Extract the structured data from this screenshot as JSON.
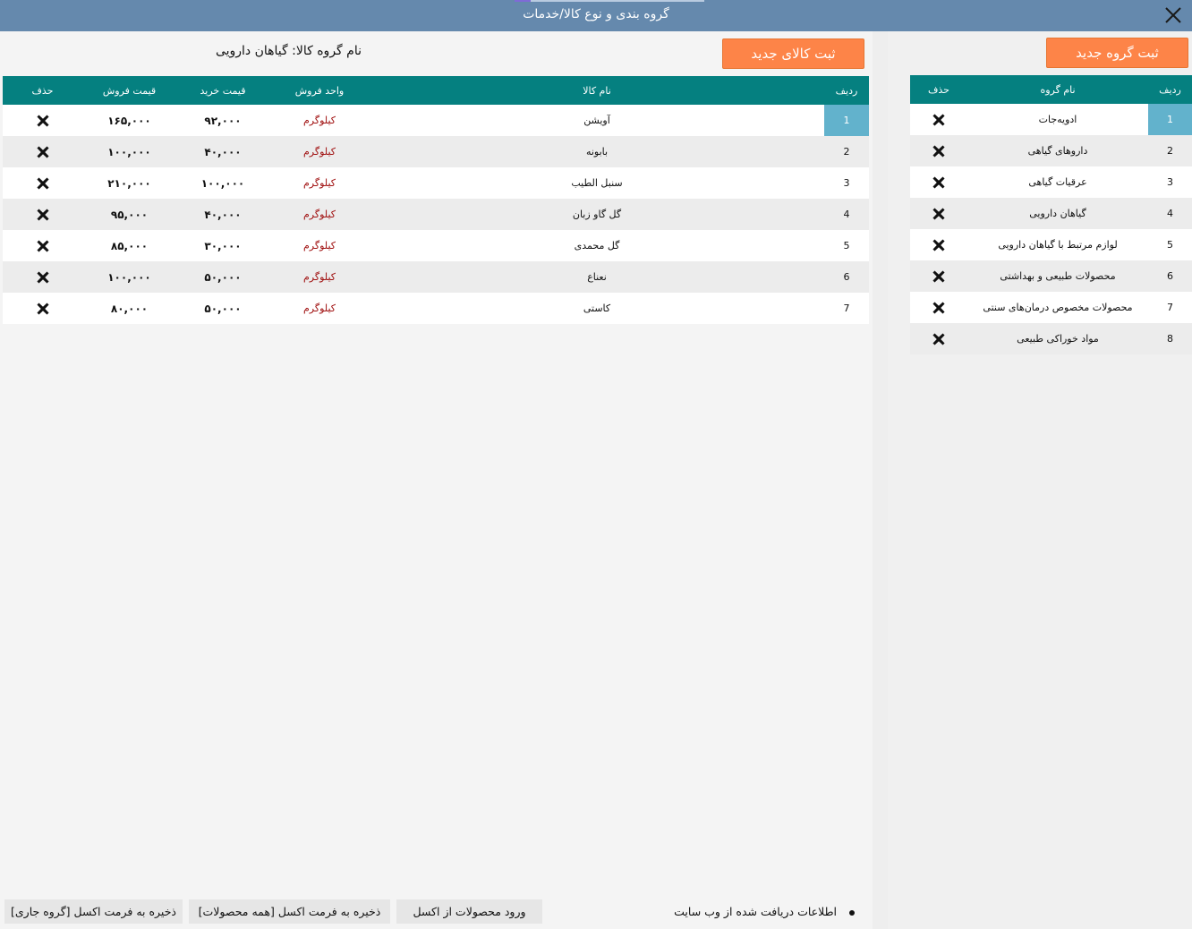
{
  "window": {
    "title": "گروه بندی و نوع کالا/خدمات"
  },
  "buttons": {
    "new_group": "ثبت گروه جدید",
    "new_product": "ثبت کالای جدید",
    "import_excel": "ورود محصولات از اکسل",
    "export_all": "ذخیره به فرمت اکسل [همه محصولات]",
    "export_current": "ذخیره به فرمت اکسل [گروه جاری]"
  },
  "selected_group": {
    "label": "نام گروه کالا:",
    "value": "گیاهان دارویی"
  },
  "status": {
    "info": "اطلاعات دریافت شده از وب سایت"
  },
  "groups_table": {
    "headers": {
      "row": "ردیف",
      "name": "نام گروه",
      "delete": "حذف"
    },
    "rows": [
      {
        "row": "1",
        "name": "ادویه‌جات"
      },
      {
        "row": "2",
        "name": "داروهای گیاهی"
      },
      {
        "row": "3",
        "name": "عرقیات گیاهی"
      },
      {
        "row": "4",
        "name": "گیاهان دارویی"
      },
      {
        "row": "5",
        "name": "لوازم مرتبط با گیاهان دارویی"
      },
      {
        "row": "6",
        "name": "محصولات طبیعی و بهداشتی"
      },
      {
        "row": "7",
        "name": "محصولات مخصوص درمان‌های سنتی"
      },
      {
        "row": "8",
        "name": "مواد خوراکی طبیعی"
      }
    ]
  },
  "products_table": {
    "headers": {
      "row": "ردیف",
      "name": "نام کالا",
      "unit": "واحد فروش",
      "buy": "قیمت خرید",
      "sell": "قیمت فروش",
      "delete": "حذف"
    },
    "rows": [
      {
        "row": "1",
        "name": "آویشن",
        "unit": "کیلوگرم",
        "buy": "۹۲,۰۰۰",
        "sell": "۱۶۵,۰۰۰"
      },
      {
        "row": "2",
        "name": "بابونه",
        "unit": "کیلوگرم",
        "buy": "۴۰,۰۰۰",
        "sell": "۱۰۰,۰۰۰"
      },
      {
        "row": "3",
        "name": "سنبل الطیب",
        "unit": "کیلوگرم",
        "buy": "۱۰۰,۰۰۰",
        "sell": "۲۱۰,۰۰۰"
      },
      {
        "row": "4",
        "name": "گل گاو زبان",
        "unit": "کیلوگرم",
        "buy": "۴۰,۰۰۰",
        "sell": "۹۵,۰۰۰"
      },
      {
        "row": "5",
        "name": "گل محمدی",
        "unit": "کیلوگرم",
        "buy": "۳۰,۰۰۰",
        "sell": "۸۵,۰۰۰"
      },
      {
        "row": "6",
        "name": "نعناع",
        "unit": "کیلوگرم",
        "buy": "۵۰,۰۰۰",
        "sell": "۱۰۰,۰۰۰"
      },
      {
        "row": "7",
        "name": "کاستی",
        "unit": "کیلوگرم",
        "buy": "۵۰,۰۰۰",
        "sell": "۸۰,۰۰۰"
      }
    ]
  },
  "colors": {
    "titlebar": "#6589ad",
    "header": "#058080",
    "orange": "#fd8448",
    "selected": "#62b2cc",
    "unit": "#a01010"
  }
}
